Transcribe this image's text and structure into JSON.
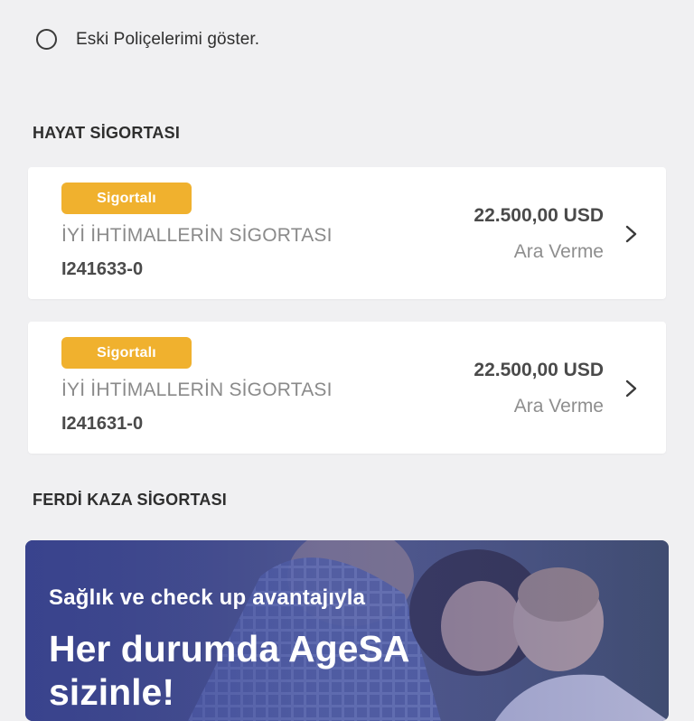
{
  "filter": {
    "label": "Eski Poliçelerimi göster."
  },
  "sections": {
    "life": {
      "title": "HAYAT SİGORTASI"
    },
    "accident": {
      "title": "FERDİ KAZA SİGORTASI"
    }
  },
  "policies": [
    {
      "badge": "Sigortalı",
      "product": "İYİ İHTİMALLERİN SİGORTASI",
      "number": "I241633-0",
      "amount": "22.500,00 USD",
      "status": "Ara Verme"
    },
    {
      "badge": "Sigortalı",
      "product": "İYİ İHTİMALLERİN SİGORTASI",
      "number": "I241631-0",
      "amount": "22.500,00 USD",
      "status": "Ara Verme"
    }
  ],
  "banner": {
    "subtitle": "Sağlık ve check up avantajıyla",
    "title": "Her durumda AgeSA sizinle!"
  },
  "colors": {
    "background": "#f0f0f2",
    "card": "#ffffff",
    "badge": "#f0b12e",
    "banner_overlay": "#3c4696"
  },
  "icons": {
    "radio": "radio-unchecked-icon",
    "chevron": "chevron-right-icon"
  }
}
